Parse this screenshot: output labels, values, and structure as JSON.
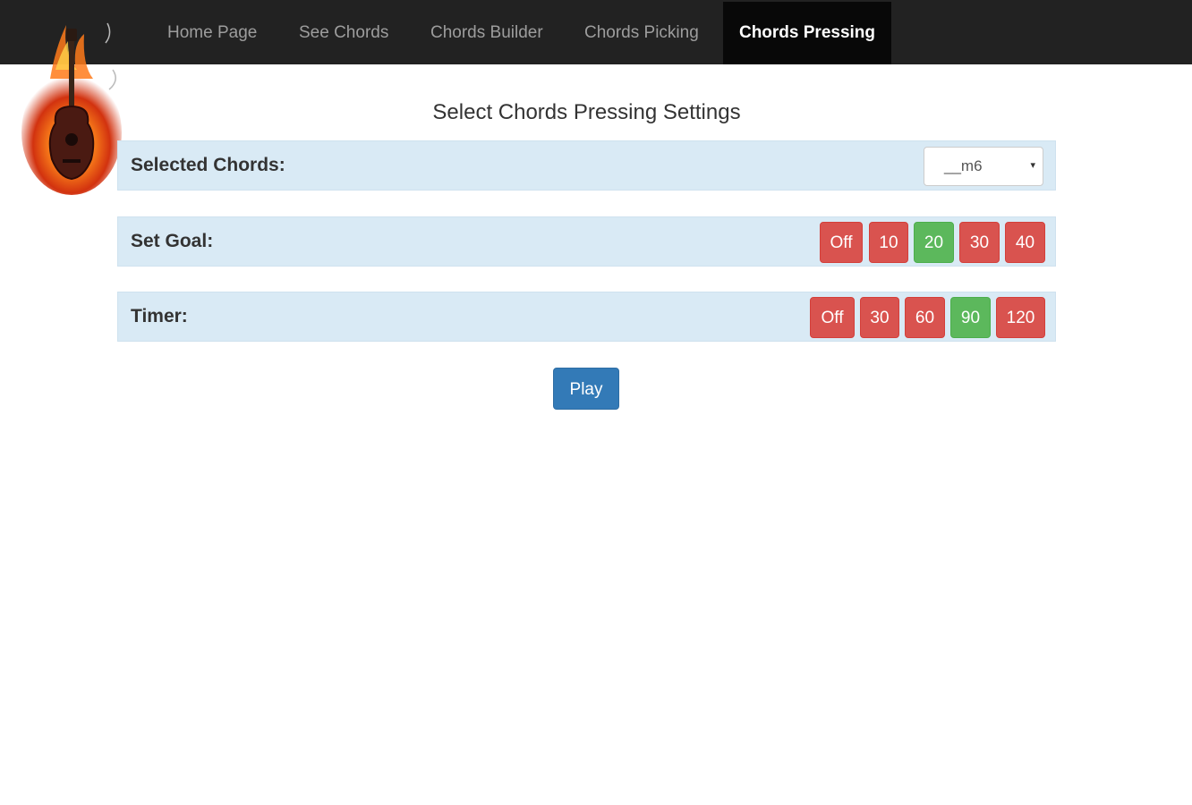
{
  "nav": {
    "items": [
      {
        "label": "Home Page"
      },
      {
        "label": "See Chords"
      },
      {
        "label": "Chords Builder"
      },
      {
        "label": "Chords Picking"
      },
      {
        "label": "Chords Pressing"
      }
    ],
    "active": "Chords Pressing"
  },
  "logo": {
    "icon": "flaming-guitar-icon"
  },
  "page_title": "Select Chords Pressing Settings",
  "selected_chords": {
    "label": "Selected Chords:",
    "value": "__m6",
    "arrow": "▾"
  },
  "goal": {
    "label": "Set Goal:",
    "options": [
      "Off",
      "10",
      "20",
      "30",
      "40"
    ],
    "selected": "20"
  },
  "timer": {
    "label": "Timer:",
    "options": [
      "Off",
      "30",
      "60",
      "90",
      "120"
    ],
    "selected": "90"
  },
  "play_label": "Play",
  "colors": {
    "navbar": "#222222",
    "active_nav": "#080808",
    "panel": "#d9eaf5",
    "off_button": "#d9534f",
    "selected_button": "#5cb85c",
    "primary_button": "#337ab7"
  }
}
